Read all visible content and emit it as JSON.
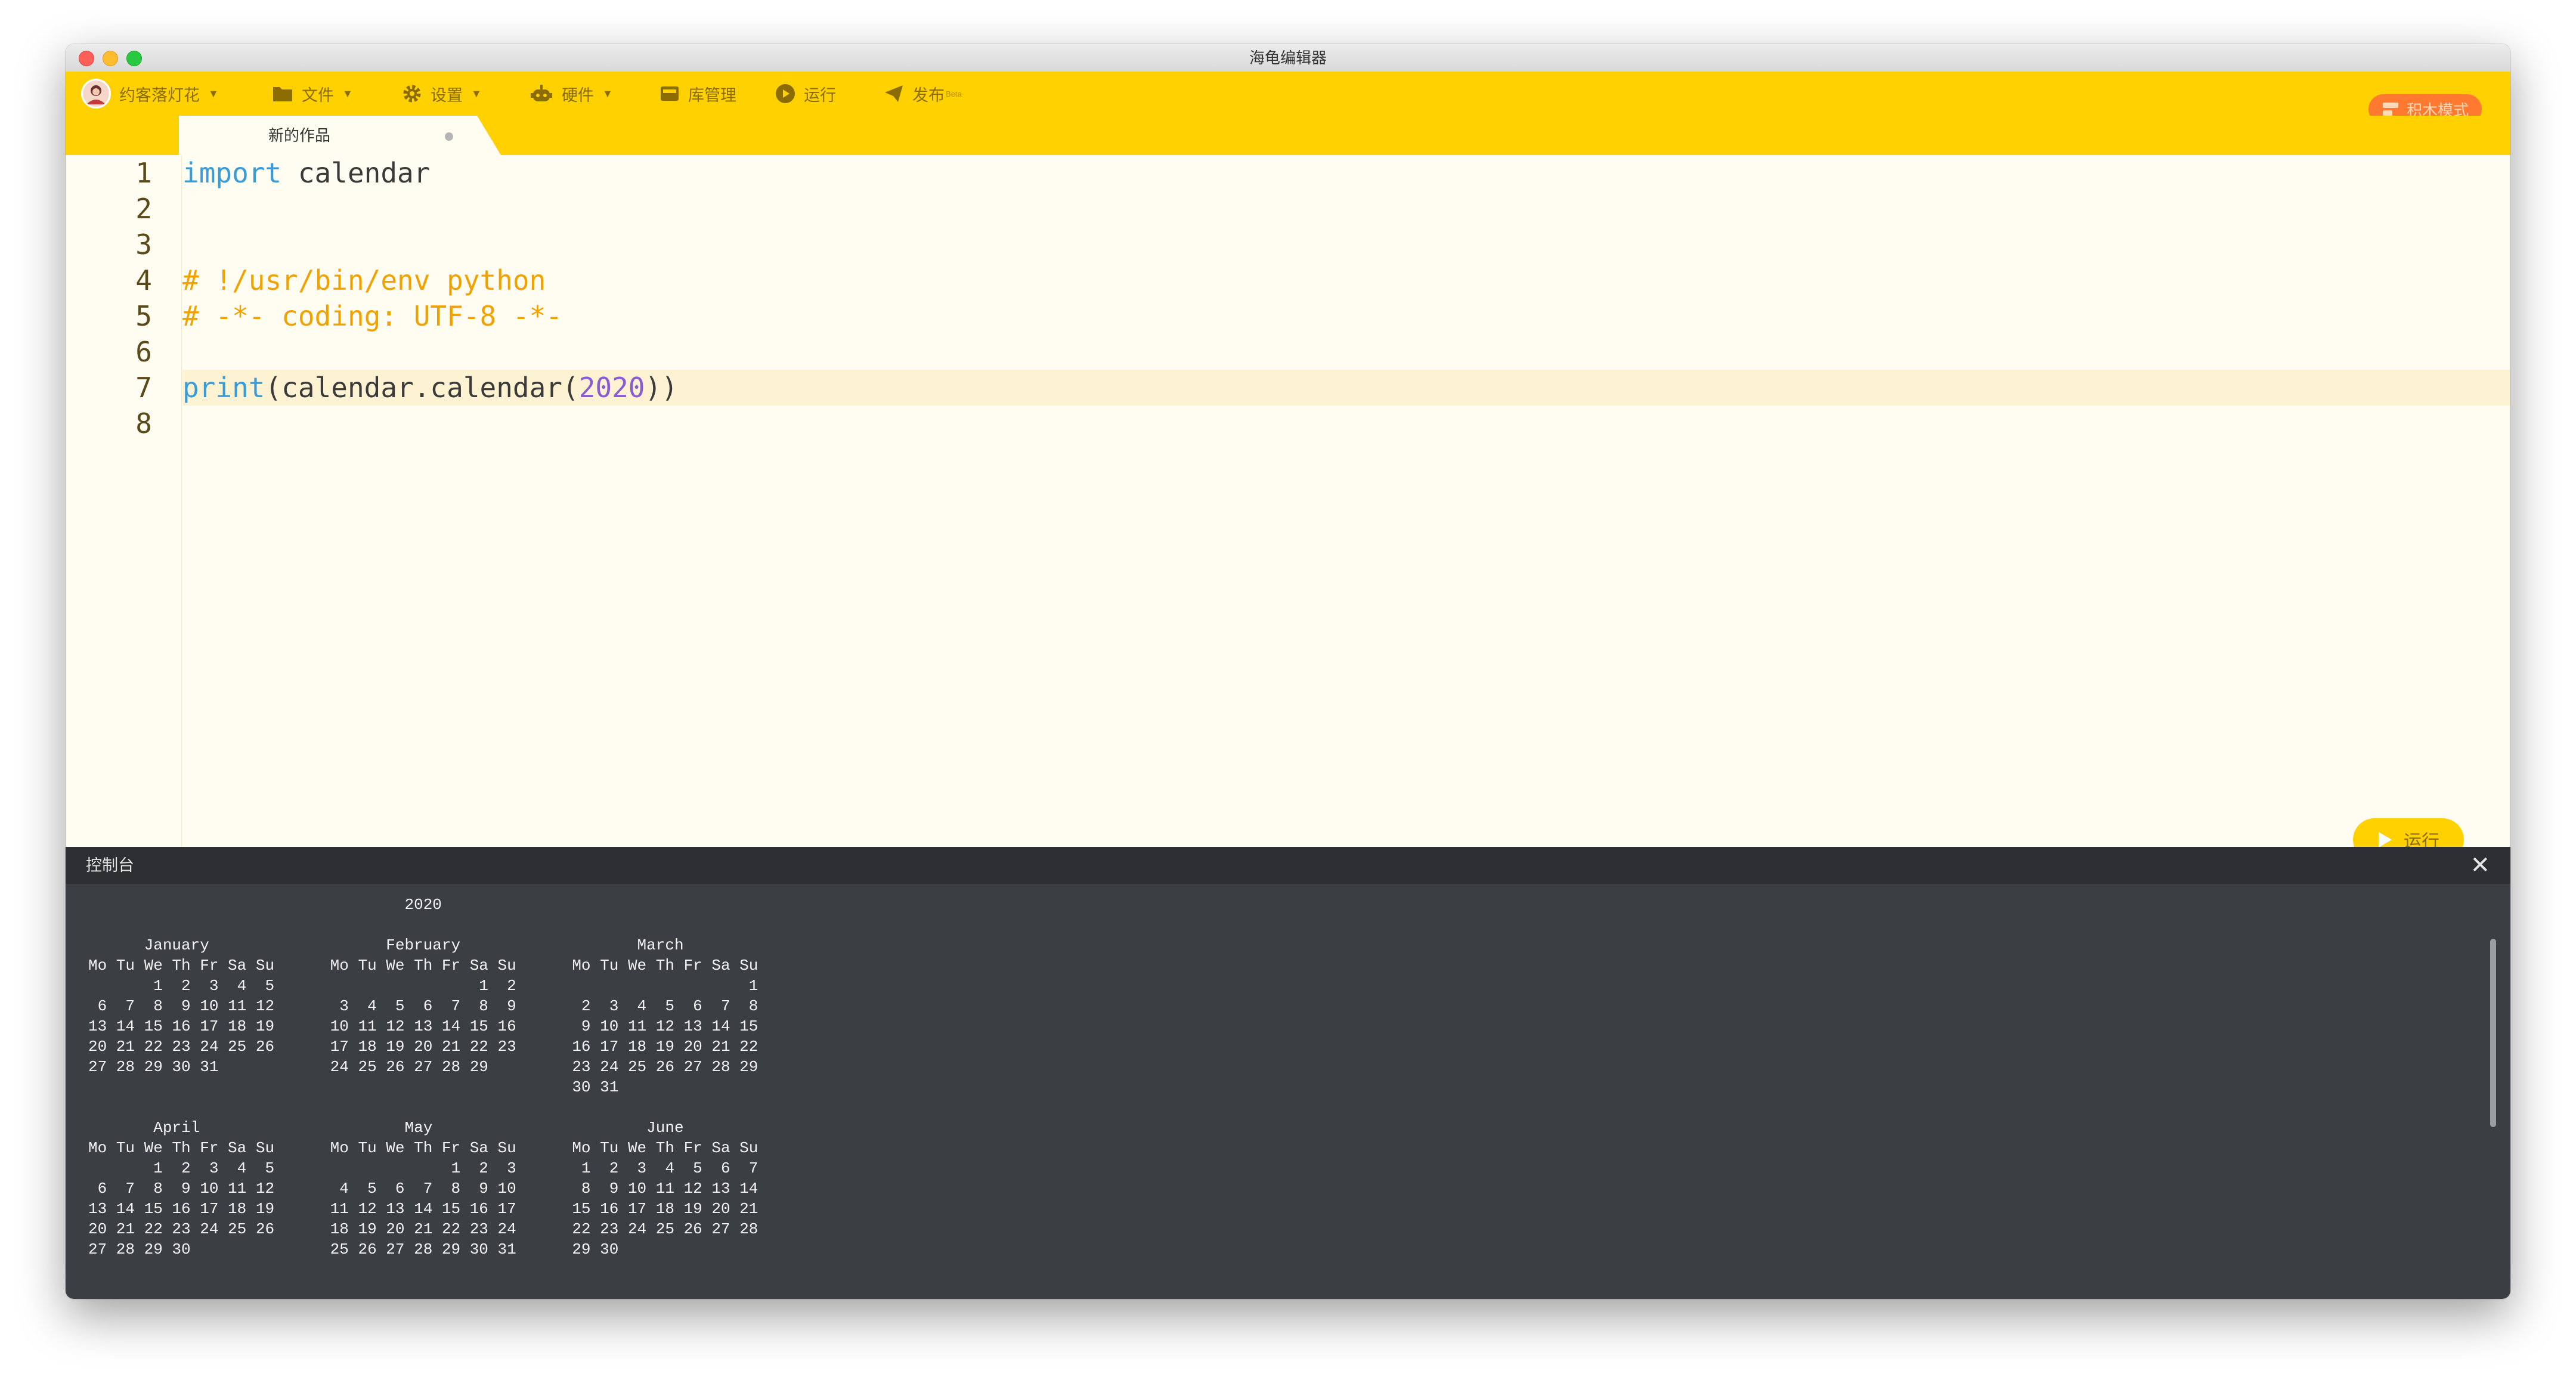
{
  "window": {
    "title": "海龟编辑器"
  },
  "toolbar": {
    "user": "约客落灯花",
    "file": "文件",
    "settings": "设置",
    "hardware": "硬件",
    "library": "库管理",
    "run": "运行",
    "publish": "发布",
    "publish_badge": "Beta",
    "block_mode": "积木模式"
  },
  "tab": {
    "title": "新的作品"
  },
  "editor": {
    "line_numbers": [
      "1",
      "2",
      "3",
      "4",
      "5",
      "6",
      "7",
      "8"
    ],
    "line1": {
      "kw": "import",
      "rest": " calendar"
    },
    "line4": "# !/usr/bin/env python",
    "line5": "# -*- coding: UTF-8 -*-",
    "line7": {
      "fn": "print",
      "a": "(calendar.calendar(",
      "num": "2020",
      "b": "))"
    },
    "run_button": "运行"
  },
  "console": {
    "title": "控制台",
    "close": "✕",
    "output": "                                  2020\n\n      January                   February                   March\nMo Tu We Th Fr Sa Su      Mo Tu We Th Fr Sa Su      Mo Tu We Th Fr Sa Su\n       1  2  3  4  5                      1  2                         1\n 6  7  8  9 10 11 12       3  4  5  6  7  8  9       2  3  4  5  6  7  8\n13 14 15 16 17 18 19      10 11 12 13 14 15 16       9 10 11 12 13 14 15\n20 21 22 23 24 25 26      17 18 19 20 21 22 23      16 17 18 19 20 21 22\n27 28 29 30 31            24 25 26 27 28 29         23 24 25 26 27 28 29\n                                                    30 31\n\n       April                      May                       June\nMo Tu We Th Fr Sa Su      Mo Tu We Th Fr Sa Su      Mo Tu We Th Fr Sa Su\n       1  2  3  4  5                   1  2  3       1  2  3  4  5  6  7\n 6  7  8  9 10 11 12       4  5  6  7  8  9 10       8  9 10 11 12 13 14\n13 14 15 16 17 18 19      11 12 13 14 15 16 17      15 16 17 18 19 20 21\n20 21 22 23 24 25 26      18 19 20 21 22 23 24      22 23 24 25 26 27 28\n27 28 29 30               25 26 27 28 29 30 31      29 30"
  },
  "colors": {
    "toolbar_bg": "#ffd100",
    "editor_bg": "#fffdf2",
    "console_bg": "#3b3e43",
    "keyword": "#3a9bd9",
    "comment": "#f0a300",
    "number": "#8a5bd6",
    "block_mode_bg": "#ff7a30"
  }
}
